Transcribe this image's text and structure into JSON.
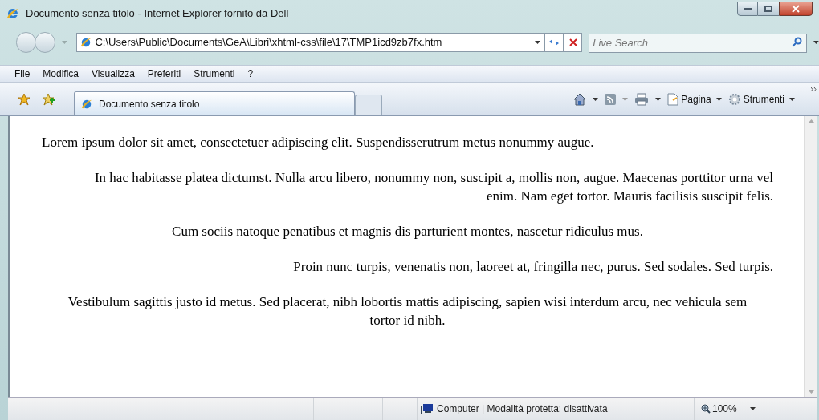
{
  "window": {
    "title": "Documento senza titolo - Internet Explorer fornito da Dell"
  },
  "address_bar": {
    "value": "C:\\Users\\Public\\Documents\\GeA\\Libri\\xhtml-css\\file\\17\\TMP1icd9zb7fx.htm"
  },
  "search": {
    "placeholder": "Live Search"
  },
  "menu": [
    "File",
    "Modifica",
    "Visualizza",
    "Preferiti",
    "Strumenti",
    "?"
  ],
  "tabs": [
    {
      "label": "Documento senza titolo",
      "selected": true
    }
  ],
  "toolbar": [
    "Pagina",
    "Strumenti"
  ],
  "paragraphs": [
    {
      "kind": "left",
      "text": "Lorem ipsum dolor sit amet, consectetuer adipiscing elit. Suspendisserutrum metus nonummy augue."
    },
    {
      "kind": "right",
      "text": "In hac habitasse platea dictumst. Nulla arcu libero, nonummy non, suscipit a, mollis non, augue. Maecenas porttitor urna vel enim. Nam eget tortor. Mauris facilisis suscipit felis."
    },
    {
      "kind": "center",
      "text": "Cum sociis natoque penatibus et magnis dis parturient montes, nascetur ridiculus mus."
    },
    {
      "kind": "right",
      "text": "Proin nunc turpis, venenatis non, laoreet at, fringilla nec, purus. Sed sodales. Sed turpis."
    },
    {
      "kind": "center",
      "text": "Vestibulum sagittis justo id metus. Sed placerat, nibh lobortis mattis adipiscing, sapien wisi interdum arcu, nec vehicula sem tortor id nibh."
    }
  ],
  "status_bar": {
    "zone": "Computer | Modalità protetta: disattivata",
    "zoom": "100%"
  }
}
